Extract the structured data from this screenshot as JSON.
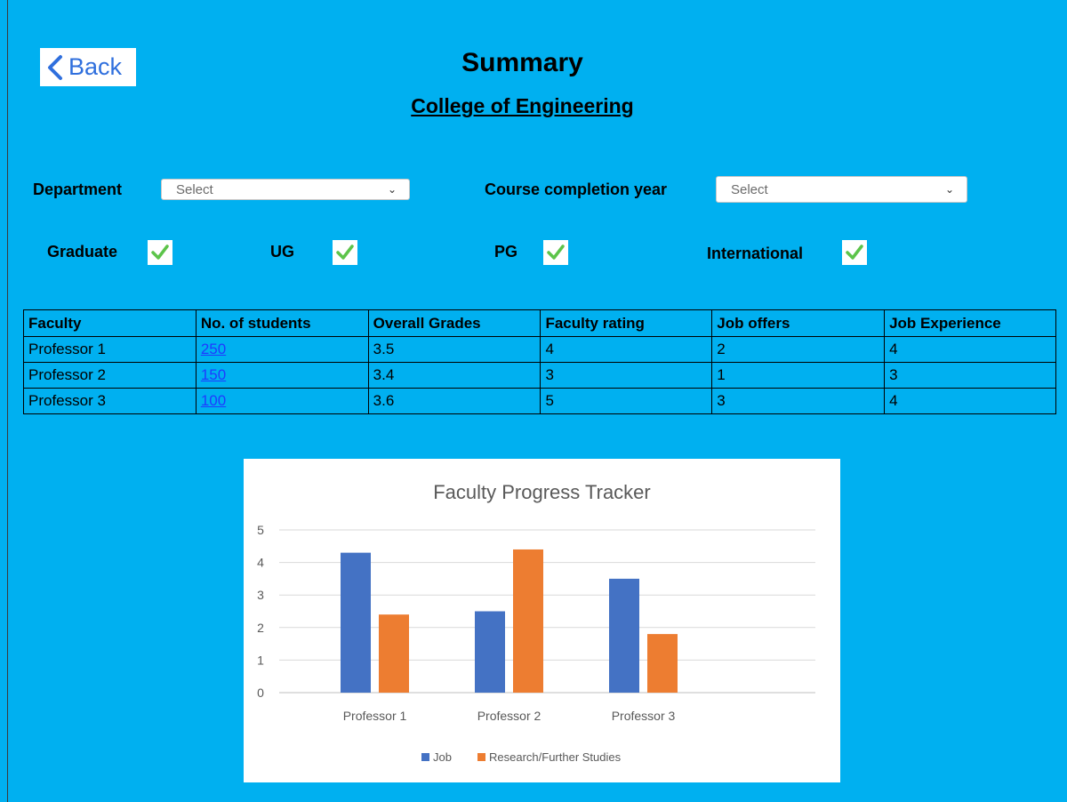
{
  "header": {
    "back_label": "Back",
    "title": "Summary",
    "subtitle": "College of Engineering"
  },
  "filters": {
    "department_label": "Department",
    "department_value": "Select",
    "year_label": "Course completion year",
    "year_value": "Select"
  },
  "checkboxes": [
    {
      "label": "Graduate",
      "checked": true
    },
    {
      "label": "UG",
      "checked": true
    },
    {
      "label": "PG",
      "checked": true
    },
    {
      "label": "International",
      "checked": true
    }
  ],
  "table": {
    "headers": [
      "Faculty",
      "No. of students",
      "Overall Grades",
      "Faculty rating",
      "Job offers",
      "Job Experience"
    ],
    "rows": [
      [
        "Professor 1",
        "250",
        "3.5",
        "4",
        "2",
        "4"
      ],
      [
        "Professor 2",
        "150",
        "3.4",
        "3",
        "1",
        "3"
      ],
      [
        "Professor 3",
        "100",
        "3.6",
        "5",
        "3",
        "4"
      ]
    ]
  },
  "colors": {
    "background": "#00b0f0",
    "check": "#5cc44a",
    "link": "#1f3bff",
    "series_job": "#4472c4",
    "series_research": "#ed7d31"
  },
  "chart_data": {
    "type": "bar",
    "title": "Faculty Progress Tracker",
    "categories": [
      "Professor 1",
      "Professor 2",
      "Professor 3"
    ],
    "series": [
      {
        "name": "Job",
        "values": [
          4.3,
          2.5,
          3.5
        ],
        "color": "#4472c4"
      },
      {
        "name": "Research/Further Studies",
        "values": [
          2.4,
          4.4,
          1.8
        ],
        "color": "#ed7d31"
      }
    ],
    "ylim": [
      0,
      5
    ],
    "yticks": [
      "0",
      "1",
      "2",
      "3",
      "4",
      "5"
    ],
    "grid": true,
    "legend": "bottom"
  }
}
